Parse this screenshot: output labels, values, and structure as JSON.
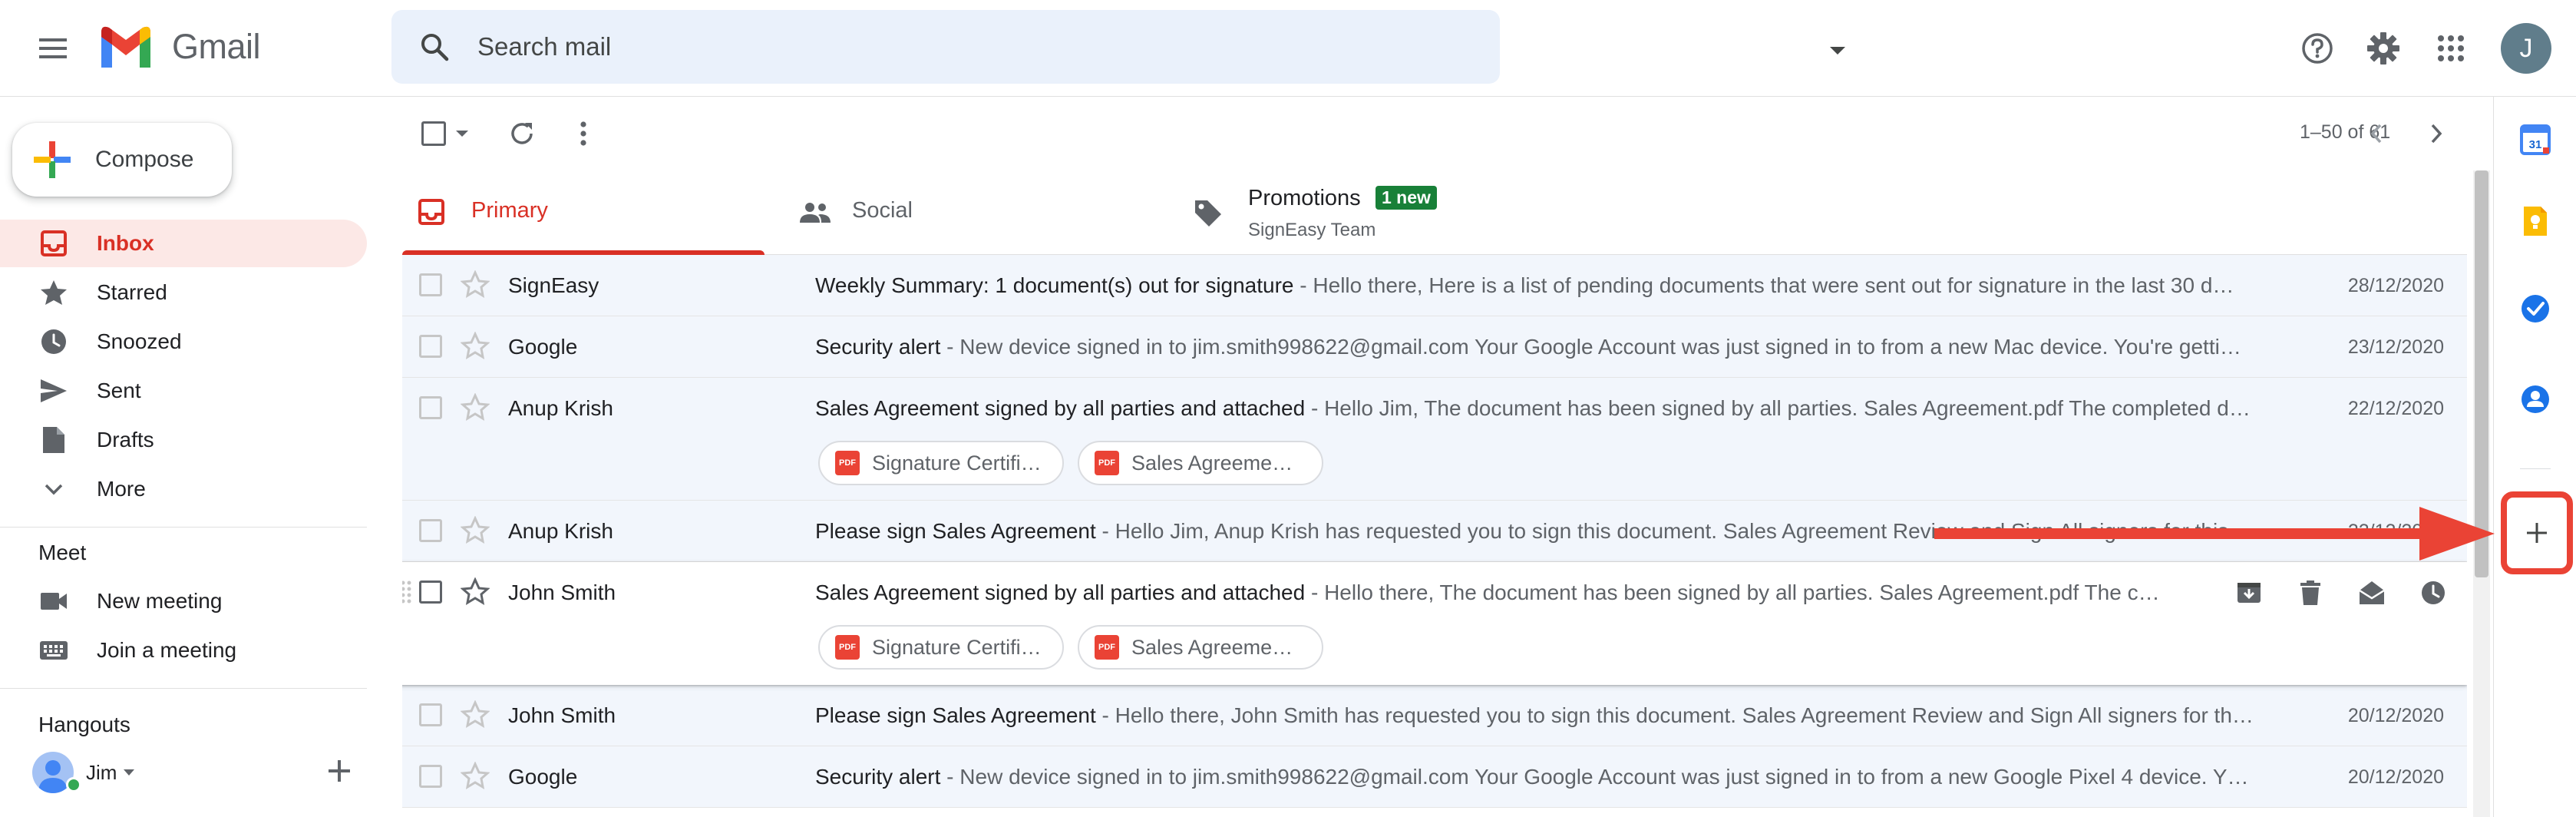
{
  "app": {
    "name": "Gmail"
  },
  "search": {
    "placeholder": "Search mail"
  },
  "header": {
    "avatar_initial": "J"
  },
  "compose": {
    "label": "Compose"
  },
  "nav": {
    "items": [
      {
        "label": "Inbox",
        "icon": "inbox-icon"
      },
      {
        "label": "Starred",
        "icon": "star-icon"
      },
      {
        "label": "Snoozed",
        "icon": "clock-icon"
      },
      {
        "label": "Sent",
        "icon": "send-icon"
      },
      {
        "label": "Drafts",
        "icon": "draft-icon"
      },
      {
        "label": "More",
        "icon": "chevron-down-icon"
      }
    ]
  },
  "meet": {
    "title": "Meet",
    "items": [
      {
        "label": "New meeting",
        "icon": "video-icon"
      },
      {
        "label": "Join a meeting",
        "icon": "keyboard-icon"
      }
    ]
  },
  "hangouts": {
    "title": "Hangouts",
    "user": "Jim"
  },
  "toolbar": {
    "pager": "1–50 of 61"
  },
  "tabs": {
    "primary": "Primary",
    "social": "Social",
    "promotions": "Promotions",
    "promotions_badge": "1 new",
    "promotions_sub": "SignEasy Team"
  },
  "emails": [
    {
      "sender": "SignEasy",
      "subject": "Weekly Summary: 1 document(s) out for signature",
      "snippet": " - Hello there, Here is a list of pending documents that were sent out for signature in the last 30 d…",
      "date": "28/12/2020"
    },
    {
      "sender": "Google",
      "subject": "Security alert",
      "snippet": " - New device signed in to jim.smith998622@gmail.com Your Google Account was just signed in to from a new Mac device. You're getti…",
      "date": "23/12/2020"
    },
    {
      "sender": "Anup Krish",
      "subject": "Sales Agreement signed by all parties and attached",
      "snippet": " - Hello Jim, The document has been signed by all parties. Sales Agreement.pdf The completed d…",
      "date": "22/12/2020",
      "attachments": [
        "Signature Certifi…",
        "Sales Agreeme…"
      ]
    },
    {
      "sender": "Anup Krish",
      "subject": "Please sign Sales Agreement",
      "snippet": " - Hello Jim, Anup Krish has requested you to sign this document. Sales Agreement Review and Sign All signers for this…",
      "date": "22/12/2020"
    },
    {
      "sender": "John Smith",
      "subject": "Sales Agreement signed by all parties and attached",
      "snippet": " - Hello there, The document has been signed by all parties. Sales Agreement.pdf The c…",
      "date": "",
      "attachments": [
        "Signature Certifi…",
        "Sales Agreeme…"
      ]
    },
    {
      "sender": "John Smith",
      "subject": "Please sign Sales Agreement",
      "snippet": " - Hello there, John Smith has requested you to sign this document. Sales Agreement Review and Sign All signers for th…",
      "date": "20/12/2020"
    },
    {
      "sender": "Google",
      "subject": "Security alert",
      "snippet": " - New device signed in to jim.smith998622@gmail.com Your Google Account was just signed in to from a new Google Pixel 4 device. Y…",
      "date": "20/12/2020"
    }
  ],
  "side_panel": {
    "calendar_day": "31",
    "icons": [
      "calendar-icon",
      "keep-icon",
      "tasks-icon",
      "contacts-icon",
      "add-addon-icon"
    ]
  },
  "colors": {
    "accent_red": "#d93025",
    "annotation_red": "#ea4335",
    "badge_green": "#188038",
    "search_bg": "#eaf1fb",
    "active_nav_bg": "#fce8e6"
  }
}
